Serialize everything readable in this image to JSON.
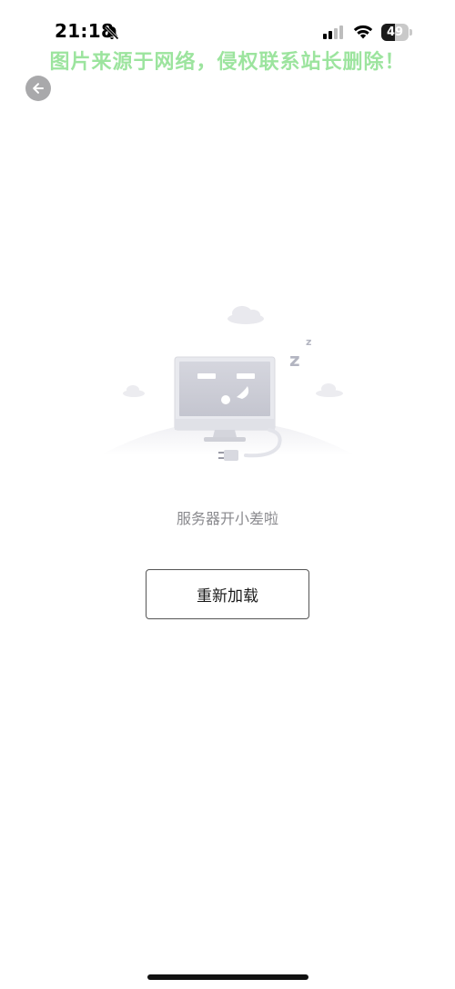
{
  "status_bar": {
    "time": "21:18",
    "battery_level": "49",
    "battery_fraction": 0.49
  },
  "watermark": {
    "text": "图片来源于网络，侵权联系站长删除！",
    "color": "#8be08e"
  },
  "navigation": {
    "back_icon": "back-arrow-icon"
  },
  "error_state": {
    "illustration": "sleeping-computer-illustration",
    "message": "服务器开小差啦",
    "sleep_letter": "z"
  },
  "actions": {
    "reload_label": "重新加载"
  },
  "colors": {
    "message_text": "#8a8a8e",
    "button_border": "#555555",
    "back_button_bg": "#a9a9ab"
  }
}
